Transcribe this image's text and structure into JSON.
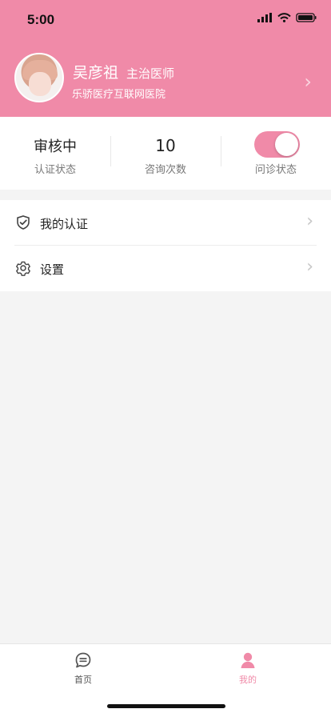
{
  "status": {
    "time": "5:00",
    "icons": [
      "signal-icon",
      "wifi-icon",
      "battery-icon"
    ]
  },
  "profile": {
    "name": "吴彦祖",
    "title": "主治医师",
    "hospital": "乐骄医疗互联网医院"
  },
  "stats": [
    {
      "value": "审核中",
      "label": "认证状态"
    },
    {
      "value": "10",
      "label": "咨询次数"
    },
    {
      "value": "",
      "label": "问诊状态",
      "toggle_on": true
    }
  ],
  "menu": [
    {
      "label": "我的认证",
      "icon": "shield-check-icon"
    },
    {
      "label": "设置",
      "icon": "gear-icon"
    }
  ],
  "tabs": [
    {
      "label": "首页",
      "icon": "chat-bubble-icon",
      "active": false
    },
    {
      "label": "我的",
      "icon": "person-icon",
      "active": true
    }
  ],
  "colors": {
    "accent": "#f08aa8",
    "background": "#f4f4f4",
    "text": "#222222",
    "muted": "#777777"
  }
}
